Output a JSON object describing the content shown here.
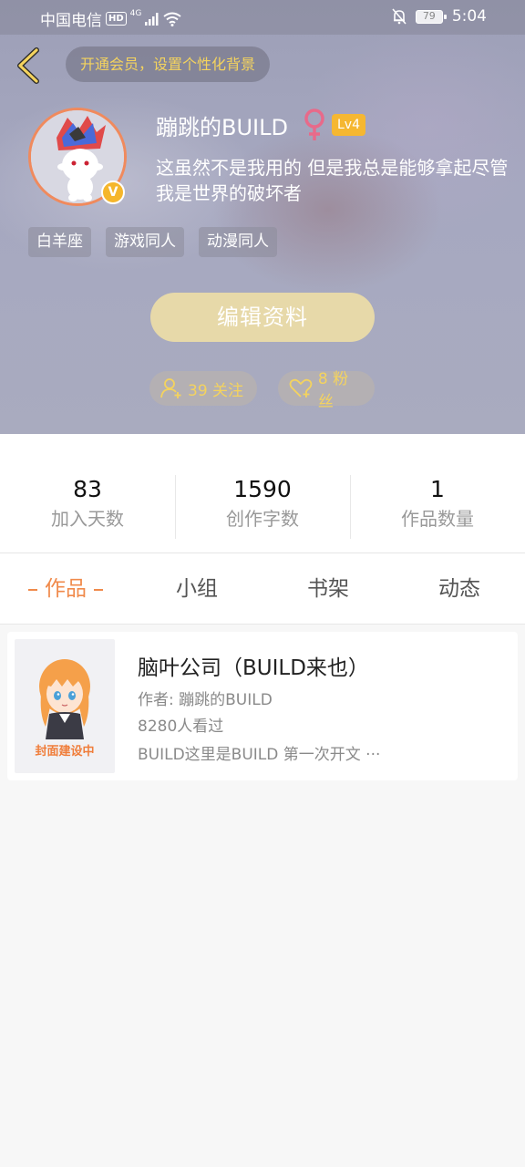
{
  "status_bar": {
    "carrier": "中国电信",
    "hd": "HD",
    "network": "4G",
    "battery": "79",
    "time": "5:04"
  },
  "header": {
    "vip_banner": "开通会员，设置个性化背景",
    "username": "蹦跳的BUILD",
    "level": "Lv4",
    "vip_mark": "V",
    "bio": "这虽然不是我用的 但是我总是能够拿起尽管我是世界的破坏者",
    "tags": [
      "白羊座",
      "游戏同人",
      "动漫同人"
    ],
    "edit_button": "编辑资料",
    "following": "39 关注",
    "fans": "8 粉丝"
  },
  "stats": [
    {
      "value": "83",
      "label": "加入天数"
    },
    {
      "value": "1590",
      "label": "创作字数"
    },
    {
      "value": "1",
      "label": "作品数量"
    }
  ],
  "tabs": [
    "作品",
    "小组",
    "书架",
    "动态"
  ],
  "work": {
    "cover_text": "封面建设中",
    "title": "脑叶公司（BUILD来也）",
    "author": "作者: 蹦跳的BUILD",
    "views": "8280人看过",
    "desc": "BUILD这里是BUILD 第一次开文 ···"
  },
  "colors": {
    "accent": "#f08a4b",
    "gold": "#f4d35e",
    "level_badge": "#f5b731",
    "edit_button": "#e7d9a9",
    "gender": "#e86a8a"
  },
  "icons": {
    "back": "chevron-left-icon",
    "gender": "female-icon",
    "following": "person-add-icon",
    "fans": "heart-icon",
    "bell": "bell-off-icon",
    "wifi": "wifi-icon",
    "signal": "signal-icon"
  }
}
